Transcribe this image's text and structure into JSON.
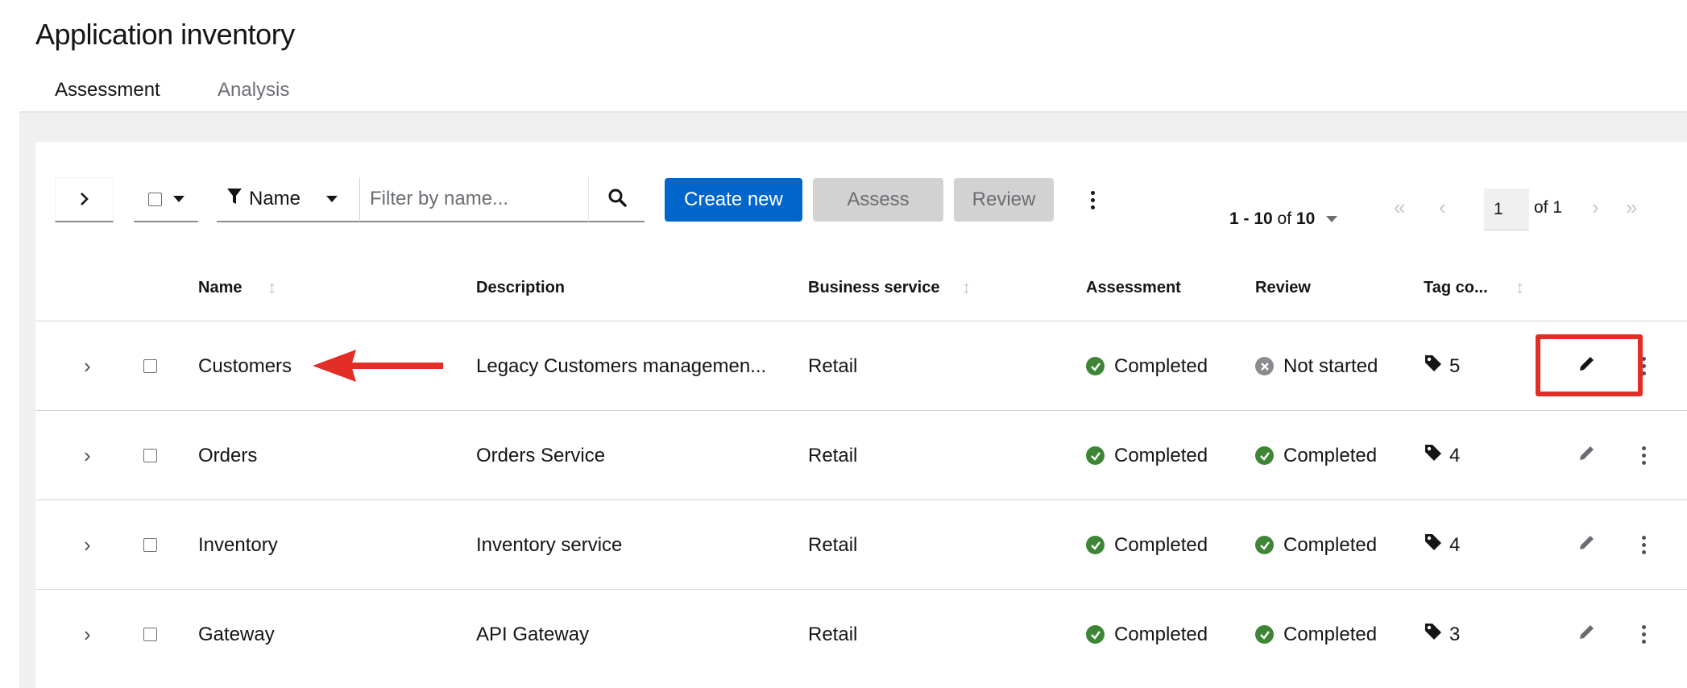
{
  "page": {
    "title": "Application inventory"
  },
  "tabs": [
    {
      "label": "Assessment"
    },
    {
      "label": "Analysis"
    }
  ],
  "toolbar": {
    "filter_label": "Name",
    "search_placeholder": "Filter by name...",
    "create_label": "Create new",
    "assess_label": "Assess",
    "review_label": "Review"
  },
  "pagination": {
    "range": "1 - 10",
    "of_text": "of",
    "total": "10",
    "page": "1",
    "page_of": "of 1"
  },
  "table": {
    "headers": {
      "name": "Name",
      "description": "Description",
      "business_service": "Business service",
      "assessment": "Assessment",
      "review": "Review",
      "tags": "Tag co..."
    },
    "rows": [
      {
        "name": "Customers",
        "description": "Legacy Customers managemen...",
        "business_service": "Retail",
        "assessment": "Completed",
        "assessment_state": "ok",
        "review": "Not started",
        "review_state": "none",
        "tags": "5"
      },
      {
        "name": "Orders",
        "description": "Orders Service",
        "business_service": "Retail",
        "assessment": "Completed",
        "assessment_state": "ok",
        "review": "Completed",
        "review_state": "ok",
        "tags": "4"
      },
      {
        "name": "Inventory",
        "description": "Inventory service",
        "business_service": "Retail",
        "assessment": "Completed",
        "assessment_state": "ok",
        "review": "Completed",
        "review_state": "ok",
        "tags": "4"
      },
      {
        "name": "Gateway",
        "description": "API Gateway",
        "business_service": "Retail",
        "assessment": "Completed",
        "assessment_state": "ok",
        "review": "Completed",
        "review_state": "ok",
        "tags": "3"
      }
    ]
  },
  "annotations": {
    "arrow_color": "#e32d27",
    "highlight_color": "#e32d27"
  },
  "colors": {
    "primary": "#0066cc",
    "success": "#3e8635",
    "neutral": "#8a8d90"
  }
}
